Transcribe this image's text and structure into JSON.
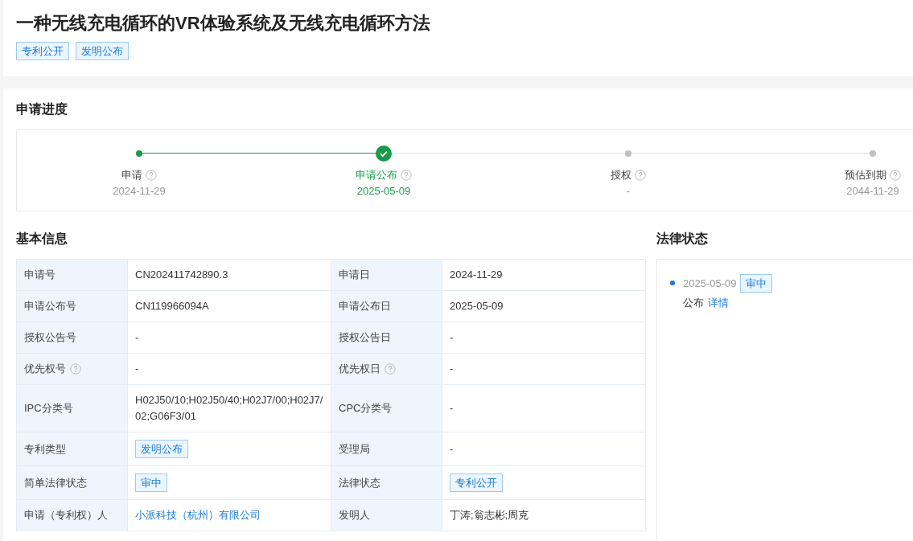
{
  "title": "一种无线充电循环的VR体验系统及无线充电循环方法",
  "tags": [
    "专利公开",
    "发明公布"
  ],
  "progress": {
    "heading": "申请进度",
    "steps": [
      {
        "label": "申请",
        "date": "2024-11-29",
        "done": true,
        "current": false
      },
      {
        "label": "申请公布",
        "date": "2025-05-09",
        "done": true,
        "current": true
      },
      {
        "label": "授权",
        "date": "-",
        "done": false,
        "current": false
      },
      {
        "label": "预估到期",
        "date": "2044-11-29",
        "done": false,
        "current": false
      }
    ]
  },
  "basic_info": {
    "heading": "基本信息",
    "rows": [
      [
        {
          "label": "申请号",
          "value": "CN202411742890.3",
          "kind": "text"
        },
        {
          "label": "申请日",
          "value": "2024-11-29",
          "kind": "text"
        }
      ],
      [
        {
          "label": "申请公布号",
          "value": "CN119966094A",
          "kind": "text"
        },
        {
          "label": "申请公布日",
          "value": "2025-05-09",
          "kind": "text"
        }
      ],
      [
        {
          "label": "授权公告号",
          "value": "-",
          "kind": "text"
        },
        {
          "label": "授权公告日",
          "value": "-",
          "kind": "text"
        }
      ],
      [
        {
          "label": "优先权号",
          "value": "-",
          "kind": "text",
          "help": true
        },
        {
          "label": "优先权日",
          "value": "-",
          "kind": "text",
          "help": true
        }
      ],
      [
        {
          "label": "IPC分类号",
          "value": "H02J50/10;H02J50/40;H02J7/00;H02J7/02;G06F3/01",
          "kind": "text"
        },
        {
          "label": "CPC分类号",
          "value": "-",
          "kind": "text"
        }
      ],
      [
        {
          "label": "专利类型",
          "value": "发明公布",
          "kind": "tag"
        },
        {
          "label": "受理局",
          "value": "-",
          "kind": "text"
        }
      ],
      [
        {
          "label": "简单法律状态",
          "value": "审中",
          "kind": "tag"
        },
        {
          "label": "法律状态",
          "value": "专利公开",
          "kind": "tag"
        }
      ],
      [
        {
          "label": "申请（专利权）人",
          "value": "小派科技（杭州）有限公司",
          "kind": "link"
        },
        {
          "label": "发明人",
          "value": "丁涛;翁志彬;周克",
          "kind": "text"
        }
      ]
    ]
  },
  "legal_status": {
    "heading": "法律状态",
    "events": [
      {
        "date": "2025-05-09",
        "tag": "审中",
        "text": "公布",
        "link": "详情"
      }
    ]
  }
}
